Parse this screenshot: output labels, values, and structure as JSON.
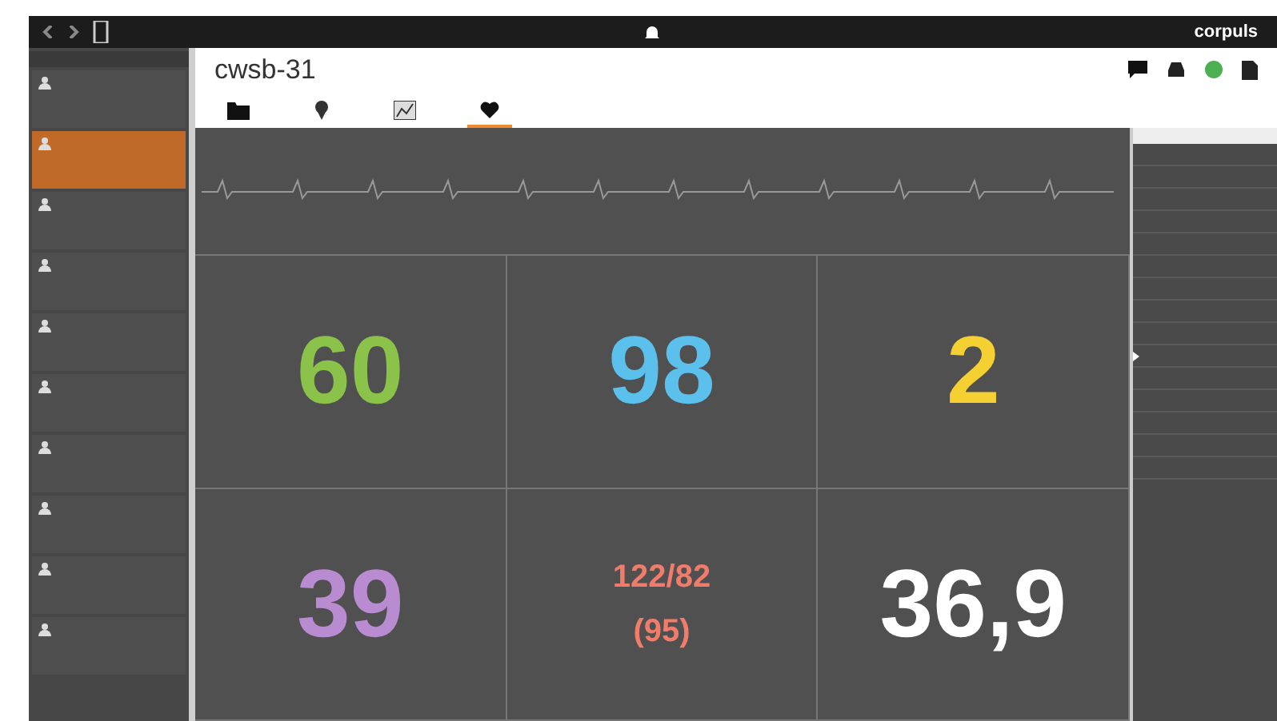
{
  "app_bar": {
    "brand": "corpuls"
  },
  "sidebar": {
    "items": [
      {
        "selected": false
      },
      {
        "selected": true
      },
      {
        "selected": false
      },
      {
        "selected": false
      },
      {
        "selected": false
      },
      {
        "selected": false
      },
      {
        "selected": false
      },
      {
        "selected": false
      },
      {
        "selected": false
      },
      {
        "selected": false
      }
    ]
  },
  "header": {
    "title": "cwsb-31"
  },
  "tabs": [
    {
      "kind": "folder",
      "selected": false
    },
    {
      "kind": "pin",
      "selected": false
    },
    {
      "kind": "chart",
      "selected": false
    },
    {
      "kind": "monitor",
      "selected": true
    }
  ],
  "vitals": [
    {
      "value": "60",
      "color": "#8bc34a"
    },
    {
      "value": "98",
      "color": "#5bc0eb"
    },
    {
      "value": "2",
      "color": "#f5d033"
    },
    {
      "value": "39",
      "color": "#b98bd0"
    },
    {
      "value": "122/82",
      "sub": "(95)",
      "color": "#f07c6c"
    },
    {
      "value": "36,9",
      "color": "#ffffff"
    }
  ],
  "events": {
    "rows": [
      {
        "marked": false
      },
      {
        "marked": false
      },
      {
        "marked": false
      },
      {
        "marked": false
      },
      {
        "marked": false
      },
      {
        "marked": false
      },
      {
        "marked": false
      },
      {
        "marked": false
      },
      {
        "marked": false
      },
      {
        "marked": true
      },
      {
        "marked": false
      },
      {
        "marked": false
      },
      {
        "marked": false
      },
      {
        "marked": false
      },
      {
        "marked": false
      }
    ]
  }
}
